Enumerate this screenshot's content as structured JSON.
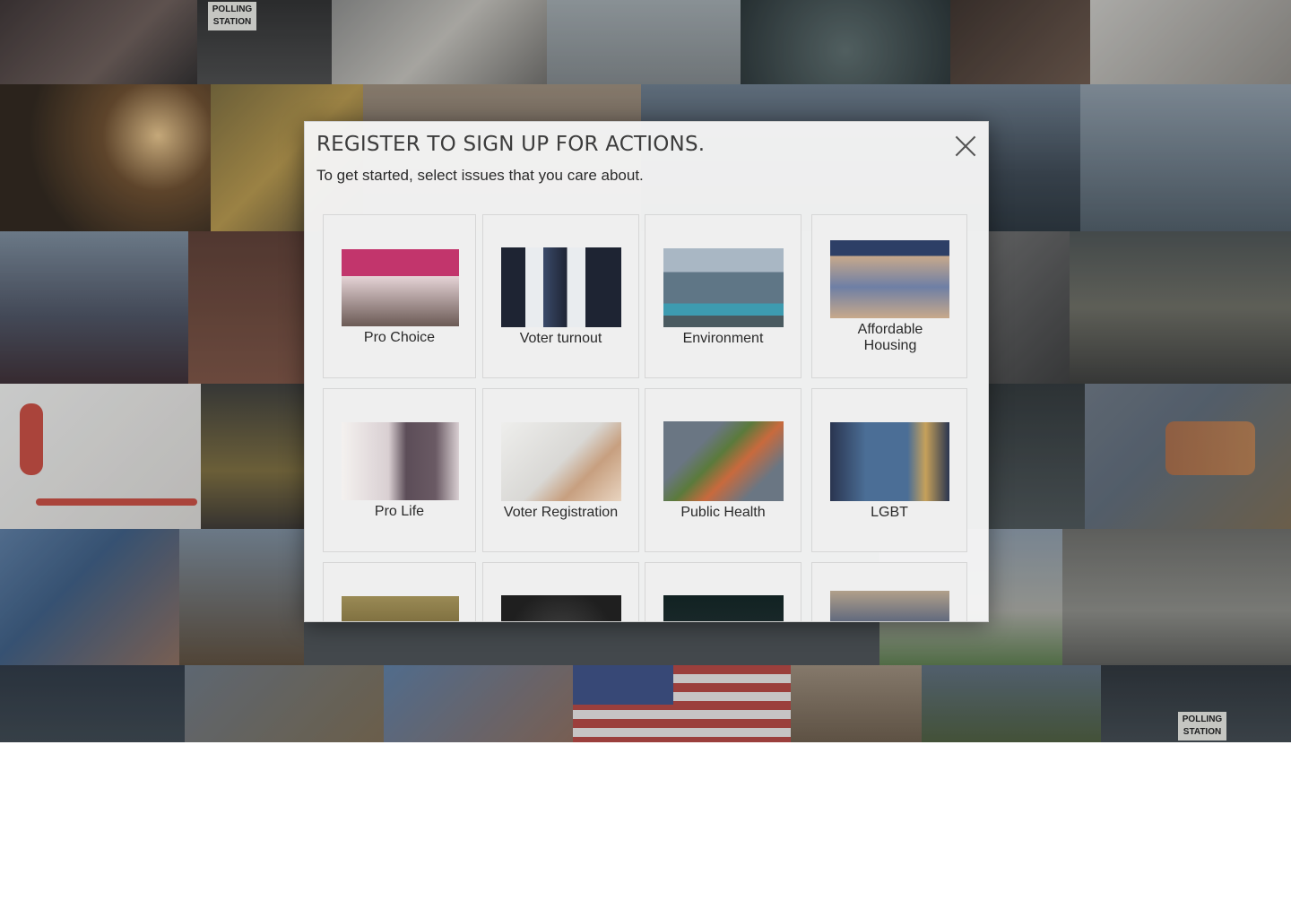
{
  "background": {
    "flag_colors": {
      "stripe_red": "#b5443f",
      "stripe_white": "#e9e6e4",
      "canton_blue": "#3b4f86"
    },
    "sign_polling_top": "POLLING STATION",
    "sign_polling_bottom": "POLLING STATION"
  },
  "modal": {
    "title": "REGISTER TO SIGN UP FOR ACTIONS.",
    "subtitle": "To get started, select issues that you care about.",
    "close_icon": "close-icon"
  },
  "issues": [
    {
      "label": "Pro Choice",
      "thumb_colors": [
        "#c2356c",
        "#e5d3d6",
        "#6b5a55"
      ]
    },
    {
      "label": "Voter turnout",
      "thumb_colors": [
        "#1e2433",
        "#e9ecef",
        "#3a4a6a"
      ]
    },
    {
      "label": "Environment",
      "thumb_colors": [
        "#a9b7c4",
        "#5f7686",
        "#3d9bb0"
      ]
    },
    {
      "label": "Affordable Housing",
      "thumb_colors": [
        "#2d3f66",
        "#c8a98b",
        "#6e7fa5"
      ]
    },
    {
      "label": "Pro Life",
      "thumb_colors": [
        "#f4f1ef",
        "#5c4d58",
        "#d9cfd2"
      ]
    },
    {
      "label": "Voter Registration",
      "thumb_colors": [
        "#d9d8d5",
        "#c79f7f",
        "#eeeeec"
      ]
    },
    {
      "label": "Public Health",
      "thumb_colors": [
        "#6a7683",
        "#c86a3d",
        "#5b7a3c"
      ]
    },
    {
      "label": "LGBT",
      "thumb_colors": [
        "#4b6e96",
        "#2a3550",
        "#c6a15a"
      ]
    },
    {
      "label": "",
      "thumb_colors": [
        "#7a6b3c",
        "#2f2a20",
        "#9a8a55"
      ]
    },
    {
      "label": "",
      "thumb_colors": [
        "#1f1f1f",
        "#bdbdbd",
        "#444"
      ]
    },
    {
      "label": "",
      "thumb_colors": [
        "#1d2a2c",
        "#3b4d4f",
        "#122"
      ]
    },
    {
      "label": "",
      "thumb_colors": [
        "#b1a08a",
        "#4a5a7a",
        "#e2c24a"
      ]
    }
  ]
}
